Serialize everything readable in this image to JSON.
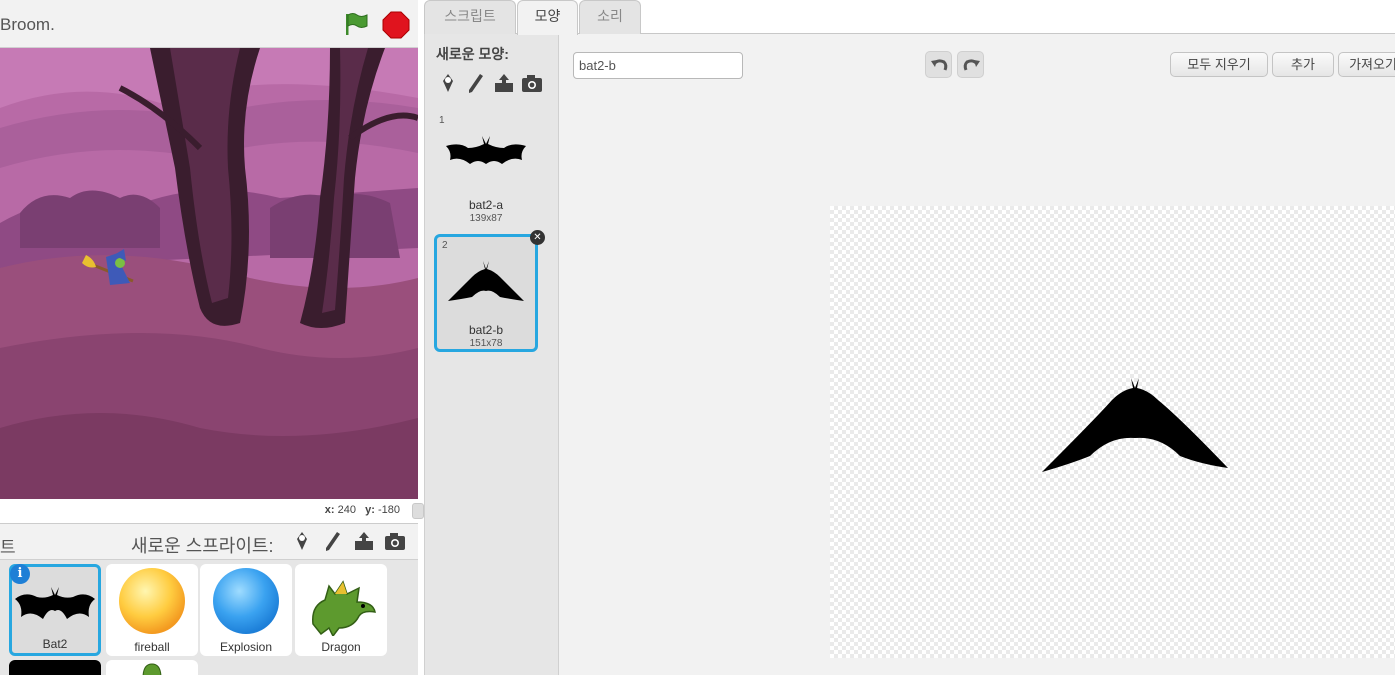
{
  "stage": {
    "project_title": "Broom.",
    "coords": {
      "x_label": "x:",
      "x_value": "240",
      "y_label": "y:",
      "y_value": "-180"
    }
  },
  "sprites": {
    "pane_title": "트",
    "new_sprite_label": "새로운 스프라이트:",
    "items": [
      {
        "name": "Bat2",
        "selected": true
      },
      {
        "name": "fireball"
      },
      {
        "name": "Explosion"
      },
      {
        "name": "Dragon"
      }
    ]
  },
  "tabs": [
    {
      "label": "스크립트"
    },
    {
      "label": "모양",
      "active": true
    },
    {
      "label": "소리"
    }
  ],
  "costumes": {
    "new_costume_label": "새로운 모양:",
    "items": [
      {
        "number": "1",
        "name": "bat2-a",
        "size": "139x87"
      },
      {
        "number": "2",
        "name": "bat2-b",
        "size": "151x78",
        "selected": true
      }
    ]
  },
  "editor": {
    "costume_name_value": "bat2-b",
    "clear_label": "모두 지우기",
    "add_label": "추가",
    "import_label": "가져오기"
  },
  "colors": {
    "selection_accent": "#27a7e0",
    "flag_green": "#3d8a2b",
    "stop_red": "#e0141e",
    "stage_sky": "#b86aa6"
  },
  "icons": [
    "green-flag-icon",
    "stop-icon",
    "paint-new-icon",
    "brush-icon",
    "upload-icon",
    "camera-icon",
    "undo-icon",
    "redo-icon",
    "delete-icon",
    "info-icon"
  ]
}
